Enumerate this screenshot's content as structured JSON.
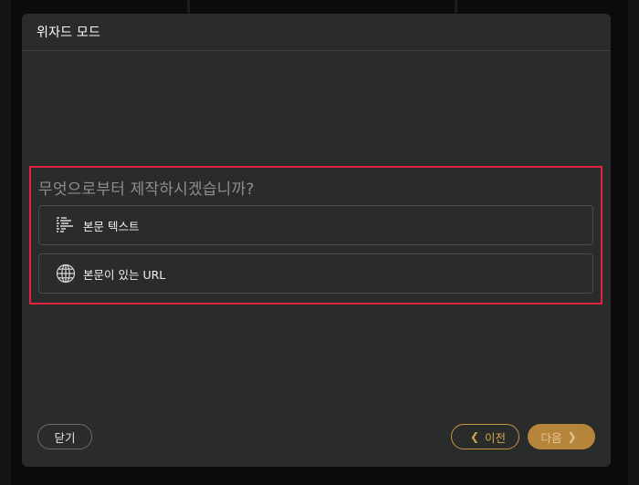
{
  "dialog": {
    "title": "위자드 모드"
  },
  "main": {
    "question": "무엇으로부터 제작하시겠습니까?",
    "options": [
      {
        "label": "본문 텍스트",
        "icon": "text-lines-icon"
      },
      {
        "label": "본문이 있는 URL",
        "icon": "globe-icon"
      }
    ]
  },
  "footer": {
    "close_label": "닫기",
    "prev_label": "이전",
    "next_label": "다음"
  },
  "colors": {
    "dialog_bg": "#2a2b2b",
    "highlight": "#e0223f",
    "accent": "#c79340"
  }
}
